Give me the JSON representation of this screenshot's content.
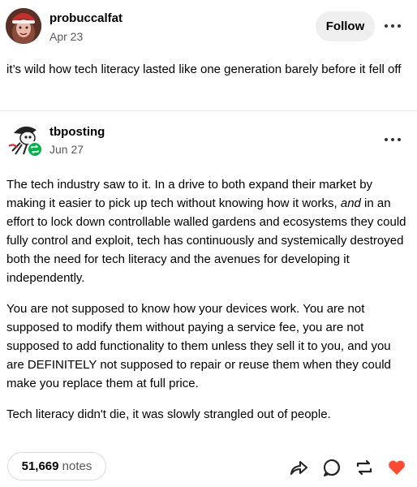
{
  "post": {
    "author": "probuccalfat",
    "date": "Apr 23",
    "follow_label": "Follow",
    "text": "it’s wild how tech literacy lasted like one generation barely before it fell off"
  },
  "reblog": {
    "author": "tbposting",
    "date": "Jun 27",
    "p1_before": "The tech industry saw to it. In a drive to both expand their market by making it easier to pick up tech without knowing how it works, ",
    "p1_em": "and",
    "p1_after": " in an effort to lock down controllable walled gardens and ecosystems they could fully control and exploit, tech has continuously and systemically destroyed both the need for tech literacy and the avenues for developing it independently.",
    "p2": "You are not supposed to know how your devices work. You are not supposed to modify them without paying a service fee, you are not supposed to add functionality to them unless they sell it to you, and you are DEFINITELY not supposed to repair or reuse them when they could make you replace them at full price.",
    "p3": "Tech literacy didn't die, it was slowly strangled out of people."
  },
  "footer": {
    "notes_count": "51,669",
    "notes_label": "notes"
  },
  "icons": {
    "share": "share-icon",
    "reply": "reply-icon",
    "reblog": "reblog-icon",
    "like": "heart-icon",
    "more": "more-options-icon"
  },
  "colors": {
    "like_red": "#ff4930",
    "reblog_green": "#00b24a",
    "follow_bg": "#efefef"
  }
}
